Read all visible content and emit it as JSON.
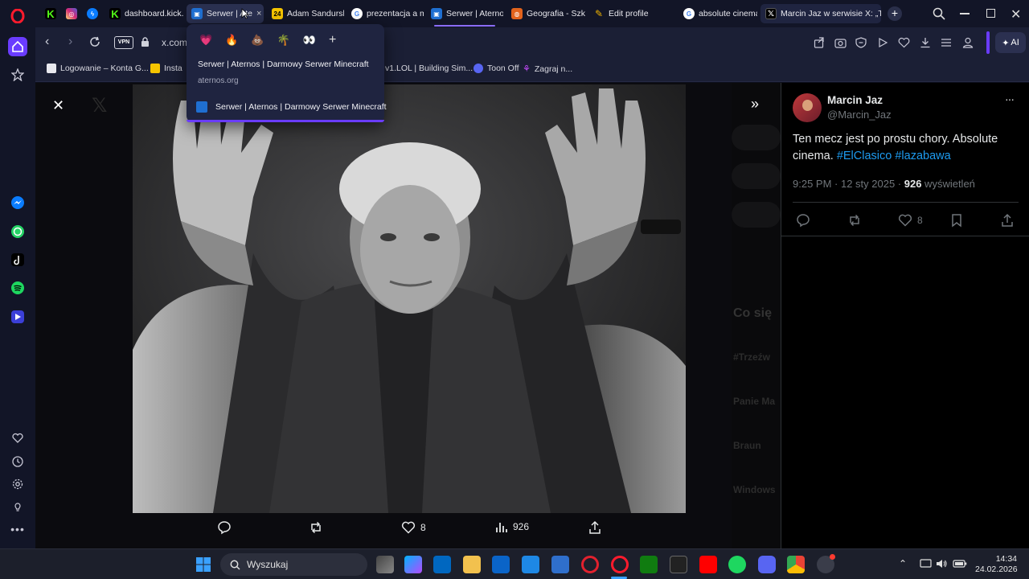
{
  "browser": {
    "tabs": [
      {
        "label": "",
        "icon": "kick-icon",
        "color": "#53fc18"
      },
      {
        "label": "",
        "icon": "instagram-icon",
        "color": "#d6249f"
      },
      {
        "label": "",
        "icon": "messenger-icon",
        "color": "#0a7cff"
      },
      {
        "label": "dashboard.kick.co",
        "icon": "kick-icon",
        "color": "#53fc18"
      },
      {
        "label": "Serwer | Ate",
        "icon": "aternos-icon",
        "color": "#1f6fd1",
        "close": "×"
      },
      {
        "label": "Adam Sandurski",
        "icon": "24-icon",
        "color": "#f5c400"
      },
      {
        "label": "prezentacja a ma",
        "icon": "google-icon",
        "color": "#ffffff"
      },
      {
        "label": "Serwer | Aternos",
        "icon": "aternos-icon",
        "color": "#1f6fd1"
      },
      {
        "label": "Geografia - Szkoł",
        "icon": "geografia-icon",
        "color": "#e2631c"
      },
      {
        "label": "Edit profile",
        "icon": "edit-profile-icon",
        "color": "#f0b400"
      },
      {
        "label": "absolute cinema",
        "icon": "google-icon",
        "color": "#ffffff"
      },
      {
        "label": "Marcin Jaz w serwisie X: „Ter",
        "icon": "x-icon",
        "color": "#000000"
      }
    ],
    "url": "x.com/",
    "vpn_label": "VPN",
    "ai_label": "AI",
    "bookmarks": [
      {
        "label": "Logowanie – Konta G...",
        "icon": "page-icon"
      },
      {
        "label": "Insta",
        "icon": "instagram-icon"
      },
      {
        "label": "v1.LOL | Building Sim...",
        "icon": "page-icon"
      },
      {
        "label": "Toon Off",
        "icon": "discord-icon"
      },
      {
        "label": "Zagraj n...",
        "icon": "page-icon"
      }
    ]
  },
  "popup": {
    "emojis": [
      "💗",
      "🔥",
      "💩",
      "🌴",
      "👀"
    ],
    "add_label": "+",
    "title": "Serwer | Aternos | Darmowy Serwer Minecraft",
    "domain": "aternos.org",
    "item_label": "Serwer | Aternos | Darmowy Serwer Minecraft"
  },
  "viewer": {
    "replies": "",
    "retweets": "",
    "likes": "8",
    "views": "926"
  },
  "tweet": {
    "display_name": "Marcin Jaz",
    "handle": "@Marcin_Jaz",
    "text_before": "Ten mecz jest po prostu chory. Absolute cinema. ",
    "hashtag1": "#ElClasico",
    "hashtag2": "#lazabawa",
    "time": "9:25 PM · 12 sty 2025 · ",
    "views_count": "926",
    "views_label": " wyświetleń",
    "likes": "8",
    "more": "···"
  },
  "background_page": {
    "trends_heading": "Co się",
    "trend1": "#Trzeźw",
    "trend2": "Panie Ma",
    "trend3": "Braun",
    "trend4": "Windows"
  },
  "taskbar": {
    "search_label": "Wyszukaj",
    "time": "14:34",
    "date": "24.02.2026"
  },
  "colors": {
    "accent": "#1d9bf0",
    "opera_red": "#ff1b2d",
    "tab_active": "#2a3050"
  }
}
